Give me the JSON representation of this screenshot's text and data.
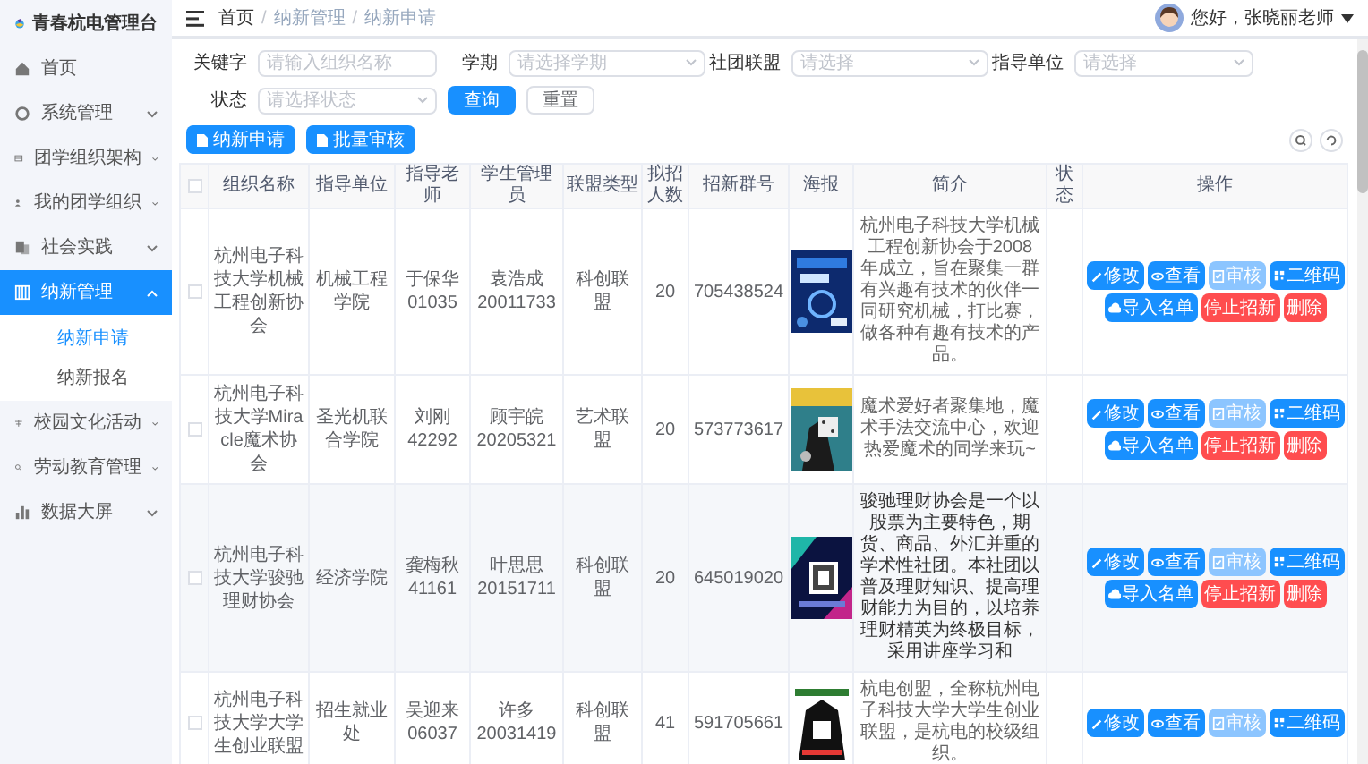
{
  "app": {
    "title": "青春杭电管理台"
  },
  "sidebar": {
    "items": [
      {
        "label": "首页",
        "selected": false
      },
      {
        "label": "系统管理",
        "expanded": false,
        "selected": false
      },
      {
        "label": "团学组织架构",
        "expanded": false,
        "selected": false
      },
      {
        "label": "我的团学组织",
        "expanded": false,
        "selected": false
      },
      {
        "label": "社会实践",
        "expanded": false,
        "selected": false
      },
      {
        "label": "纳新管理",
        "expanded": true,
        "selected": true,
        "children": [
          {
            "label": "纳新申请",
            "selected": true
          },
          {
            "label": "纳新报名",
            "selected": false
          }
        ]
      },
      {
        "label": "校园文化活动",
        "expanded": false,
        "selected": false
      },
      {
        "label": "劳动教育管理",
        "expanded": false,
        "selected": false
      },
      {
        "label": "数据大屏",
        "expanded": false,
        "selected": false
      }
    ]
  },
  "breadcrumb": [
    {
      "label": "首页",
      "kind": "link"
    },
    {
      "label": "/",
      "kind": "separator"
    },
    {
      "label": "纳新管理",
      "kind": "current"
    },
    {
      "label": "/",
      "kind": "separator"
    },
    {
      "label": "纳新申请",
      "kind": "current"
    }
  ],
  "user": {
    "greeting": "您好，张晓丽老师"
  },
  "filters": [
    {
      "label": "关键字",
      "kind": "input",
      "placeholder": "请输入组织名称"
    },
    {
      "label": "学期",
      "kind": "select",
      "placeholder": "请选择学期"
    },
    {
      "label": "社团联盟",
      "kind": "select",
      "placeholder": "请选择"
    },
    {
      "label": "指导单位",
      "kind": "select",
      "placeholder": "请选择"
    },
    {
      "label": "状态",
      "kind": "select",
      "placeholder": "请选择状态"
    }
  ],
  "filter_buttons": [
    {
      "label": "查询",
      "kind": "primary"
    },
    {
      "label": "重置",
      "kind": "plain"
    }
  ],
  "toolbar": [
    "纳新申请",
    "批量审核"
  ],
  "table": {
    "select_all_checked": false,
    "columns": [
      "组织名称",
      "指导单位",
      "指导老师",
      "学生管理员",
      "联盟类型",
      "拟招人数",
      "招新群号",
      "海报",
      "简介",
      "状态",
      "操作"
    ],
    "rows": [
      {
        "checked": false,
        "highlighted": false,
        "name": "杭州电子科技大学机械工程创新协会",
        "unit": "机械工程学院",
        "teacher": "于保华\n01035",
        "admin": "袁浩成\n20011733",
        "type": "科创联盟",
        "count": "20",
        "group": "705438524",
        "poster": {
          "kind": "picture"
        },
        "intro": "杭州电子科技大学机械工程创新协会于2008年成立，旨在聚集一群有兴趣有技术的伙伴一同研究机械，打比赛，做各种有趣有技术的产品。",
        "actions": [
          {
            "label": "修改",
            "kind": "primary",
            "disabled": false
          },
          {
            "label": "查看",
            "kind": "primary",
            "disabled": false
          },
          {
            "label": "审核",
            "kind": "primary",
            "disabled": true
          },
          {
            "label": "二维码",
            "kind": "primary",
            "disabled": false
          },
          {
            "label": "导入名单",
            "kind": "primary",
            "disabled": false
          },
          {
            "label": "停止招新",
            "kind": "danger",
            "disabled": false
          },
          {
            "label": "删除",
            "kind": "danger",
            "disabled": false
          }
        ]
      },
      {
        "checked": false,
        "highlighted": false,
        "name": "杭州电子科技大学Miracle魔术协会",
        "unit": "圣光机联合学院",
        "teacher": "刘刚\n42292",
        "admin": "顾宇皖\n20205321",
        "type": "艺术联盟",
        "count": "20",
        "group": "573773617",
        "poster": {
          "kind": "picture"
        },
        "intro": "魔术爱好者聚集地，魔术手法交流中心，欢迎热爱魔术的同学来玩~",
        "actions": [
          {
            "label": "修改",
            "kind": "primary",
            "disabled": false
          },
          {
            "label": "查看",
            "kind": "primary",
            "disabled": false
          },
          {
            "label": "审核",
            "kind": "primary",
            "disabled": true
          },
          {
            "label": "二维码",
            "kind": "primary",
            "disabled": false
          },
          {
            "label": "导入名单",
            "kind": "primary",
            "disabled": false
          },
          {
            "label": "停止招新",
            "kind": "danger",
            "disabled": false
          },
          {
            "label": "删除",
            "kind": "danger",
            "disabled": false
          }
        ]
      },
      {
        "checked": false,
        "highlighted": true,
        "name": "杭州电子科技大学骏驰理财协会",
        "unit": "经济学院",
        "teacher": "龚梅秋\n41161",
        "admin": "叶思思\n20151711",
        "type": "科创联盟",
        "count": "20",
        "group": "645019020",
        "poster": {
          "kind": "picture"
        },
        "intro": "骏驰理财协会是一个以股票为主要特色，期货、商品、外汇并重的学术性社团。本社团以普及理财知识、提高理财能力为目的，以培养理财精英为终极目标，采用讲座学习和",
        "actions": [
          {
            "label": "修改",
            "kind": "primary",
            "disabled": false
          },
          {
            "label": "查看",
            "kind": "primary",
            "disabled": false
          },
          {
            "label": "审核",
            "kind": "primary",
            "disabled": true
          },
          {
            "label": "二维码",
            "kind": "primary",
            "disabled": false
          },
          {
            "label": "导入名单",
            "kind": "primary",
            "disabled": false
          },
          {
            "label": "停止招新",
            "kind": "danger",
            "disabled": false
          },
          {
            "label": "删除",
            "kind": "danger",
            "disabled": false
          }
        ]
      },
      {
        "checked": false,
        "highlighted": false,
        "name": "杭州电子科技大学大学生创业联盟",
        "unit": "招生就业处",
        "teacher": "吴迎来\n06037",
        "admin": "许多\n20031419",
        "type": "科创联盟",
        "count": "41",
        "group": "591705661",
        "poster": {
          "kind": "picture"
        },
        "intro": "杭电创盟，全称杭州电子科技大学大学生创业联盟，是杭电的校级组织。",
        "actions": [
          {
            "label": "修改",
            "kind": "primary",
            "disabled": false
          },
          {
            "label": "查看",
            "kind": "primary",
            "disabled": false
          },
          {
            "label": "审核",
            "kind": "primary",
            "disabled": true
          },
          {
            "label": "二维码",
            "kind": "primary",
            "disabled": false
          }
        ]
      }
    ]
  }
}
